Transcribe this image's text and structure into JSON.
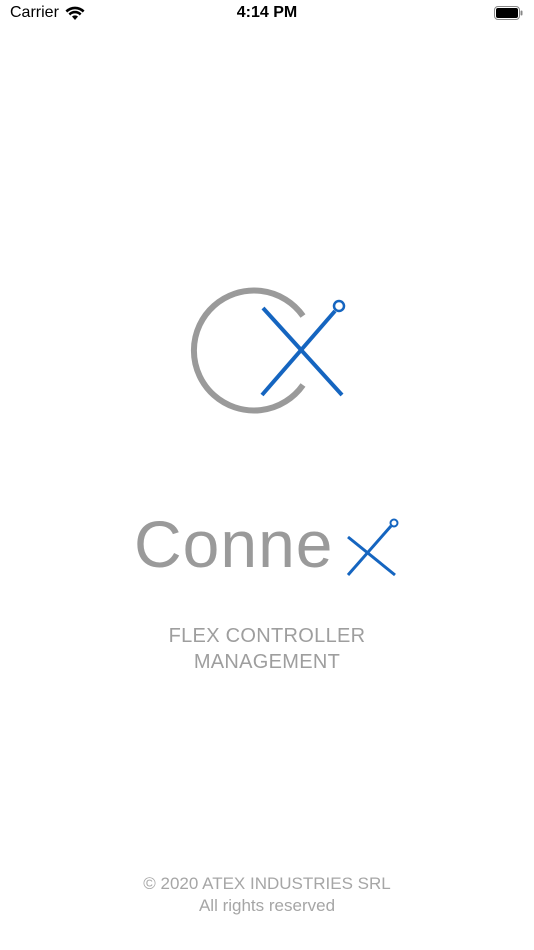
{
  "status_bar": {
    "carrier": "Carrier",
    "time": "4:14 PM",
    "wifi_icon": "wifi-icon",
    "battery_icon": "battery-icon"
  },
  "brand": {
    "wordmark": "Conne",
    "wordmark_suffix": "X",
    "primary_color": "#1565c0",
    "secondary_color": "#9a9a9a"
  },
  "subtitle": {
    "line1": "FLEX CONTROLLER",
    "line2": "MANAGEMENT"
  },
  "footer": {
    "copyright": "© 2020 ATEX INDUSTRIES SRL",
    "rights": "All rights reserved"
  }
}
